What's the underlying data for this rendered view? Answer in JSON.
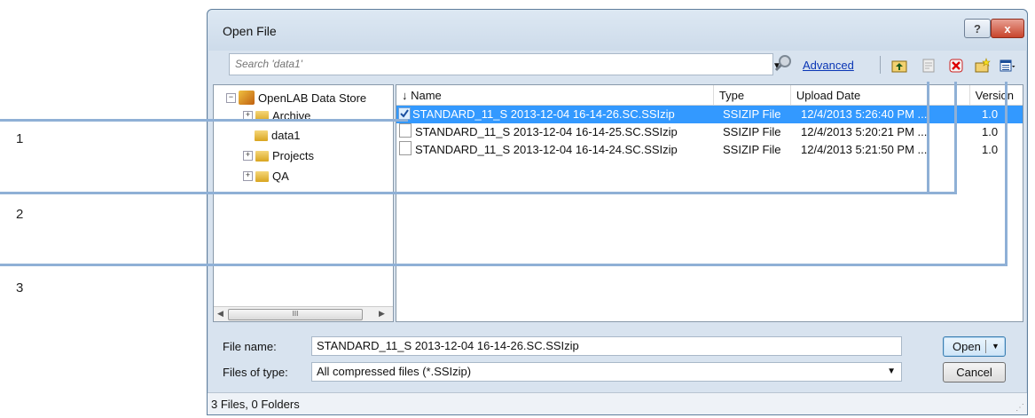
{
  "callouts": [
    "1",
    "2",
    "3"
  ],
  "dialog": {
    "title": "Open File",
    "help_label": "?",
    "close_label": "x"
  },
  "toolbar": {
    "search_placeholder": "Search 'data1'",
    "advanced_label": "Advanced"
  },
  "tree": {
    "root": "OpenLAB Data Store",
    "items": [
      {
        "label": "Archive",
        "expander": "+"
      },
      {
        "label": "data1",
        "expander": ""
      },
      {
        "label": "Projects",
        "expander": "+"
      },
      {
        "label": "QA",
        "expander": "+"
      }
    ],
    "root_expander": "−",
    "scroll_thumb": "III"
  },
  "list": {
    "columns": [
      "↓ Name",
      "Type",
      "Upload Date",
      "Version"
    ],
    "rows": [
      {
        "name": "STANDARD_11_S 2013-12-04 16-14-26.SC.SSIzip",
        "type": "SSIZIP File",
        "date": "12/4/2013 5:26:40 PM ...",
        "version": "1.0",
        "selected": true
      },
      {
        "name": "STANDARD_11_S 2013-12-04 16-14-25.SC.SSIzip",
        "type": "SSIZIP File",
        "date": "12/4/2013 5:20:21 PM ...",
        "version": "1.0",
        "selected": false
      },
      {
        "name": "STANDARD_11_S 2013-12-04 16-14-24.SC.SSIzip",
        "type": "SSIZIP File",
        "date": "12/4/2013 5:21:50 PM ...",
        "version": "1.0",
        "selected": false
      }
    ]
  },
  "bottom": {
    "file_name_label": "File name:",
    "file_name_value": "STANDARD_11_S 2013-12-04 16-14-26.SC.SSIzip",
    "file_type_label": "Files of type:",
    "file_type_value": "All compressed files (*.SSIzip)",
    "open_label": "Open",
    "cancel_label": "Cancel"
  },
  "status": "3 Files, 0 Folders",
  "colors": {
    "selection": "#3399ff",
    "callout_line": "#8fb0d6",
    "link": "#0a36b5"
  }
}
